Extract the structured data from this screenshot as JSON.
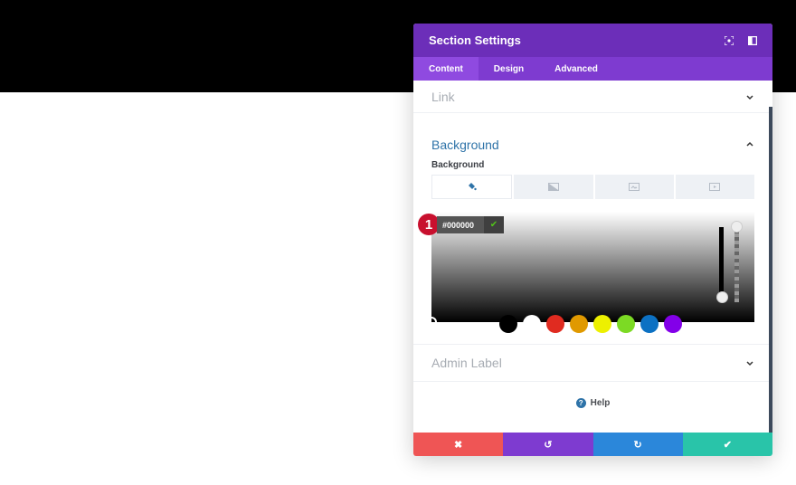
{
  "modal": {
    "title": "Section Settings",
    "tabs": [
      {
        "label": "Content",
        "active": true
      },
      {
        "label": "Design",
        "active": false
      },
      {
        "label": "Advanced",
        "active": false
      }
    ]
  },
  "sections": {
    "link": {
      "title": "Link"
    },
    "background": {
      "title": "Background",
      "field_label": "Background",
      "type_tabs": [
        "color",
        "gradient",
        "image",
        "video"
      ],
      "hex_value": "#000000",
      "step_badge": "1",
      "swatches": [
        "#000000",
        "#ffffff",
        "#e02b20",
        "#e09900",
        "#edf000",
        "#7cda24",
        "#0c71c3",
        "#8300e9"
      ]
    },
    "admin_label": {
      "title": "Admin Label"
    }
  },
  "help": {
    "label": "Help"
  },
  "footer": {
    "cancel": "✖",
    "undo": "↺",
    "redo": "↻",
    "save": "✔",
    "colors": {
      "cancel": "#ef5555",
      "undo": "#7e3bd0",
      "redo": "#2b87da",
      "save": "#29c4a9"
    }
  }
}
